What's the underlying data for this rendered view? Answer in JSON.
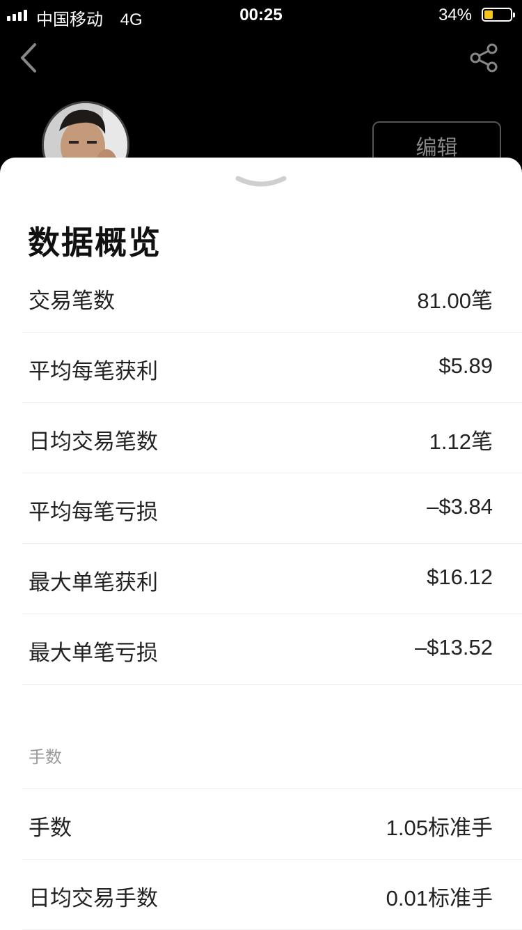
{
  "status_bar": {
    "carrier": "中国移动",
    "network": "4G",
    "time": "00:25",
    "battery": "34%",
    "battery_level": 0.34
  },
  "nav": {
    "back_icon": "chevron-left-icon",
    "share_icon": "share-icon"
  },
  "profile": {
    "edit_label": "编辑"
  },
  "sheet": {
    "title": "数据概览",
    "rows": [
      {
        "label": "交易笔数",
        "value": "81.00笔"
      },
      {
        "label": "平均每笔获利",
        "value": "$5.89"
      },
      {
        "label": "日均交易笔数",
        "value": "1.12笔"
      },
      {
        "label": "平均每笔亏损",
        "value": "–$3.84"
      },
      {
        "label": "最大单笔获利",
        "value": "$16.12"
      },
      {
        "label": "最大单笔亏损",
        "value": "–$13.52"
      }
    ],
    "section_label": "手数",
    "lot_rows": [
      {
        "label": "手数",
        "value": "1.05标准手"
      },
      {
        "label": "日均交易手数",
        "value": "0.01标准手"
      }
    ]
  },
  "colors": {
    "battery_fill": "#f5c518",
    "background_top": "#000000",
    "sheet": "#ffffff"
  }
}
